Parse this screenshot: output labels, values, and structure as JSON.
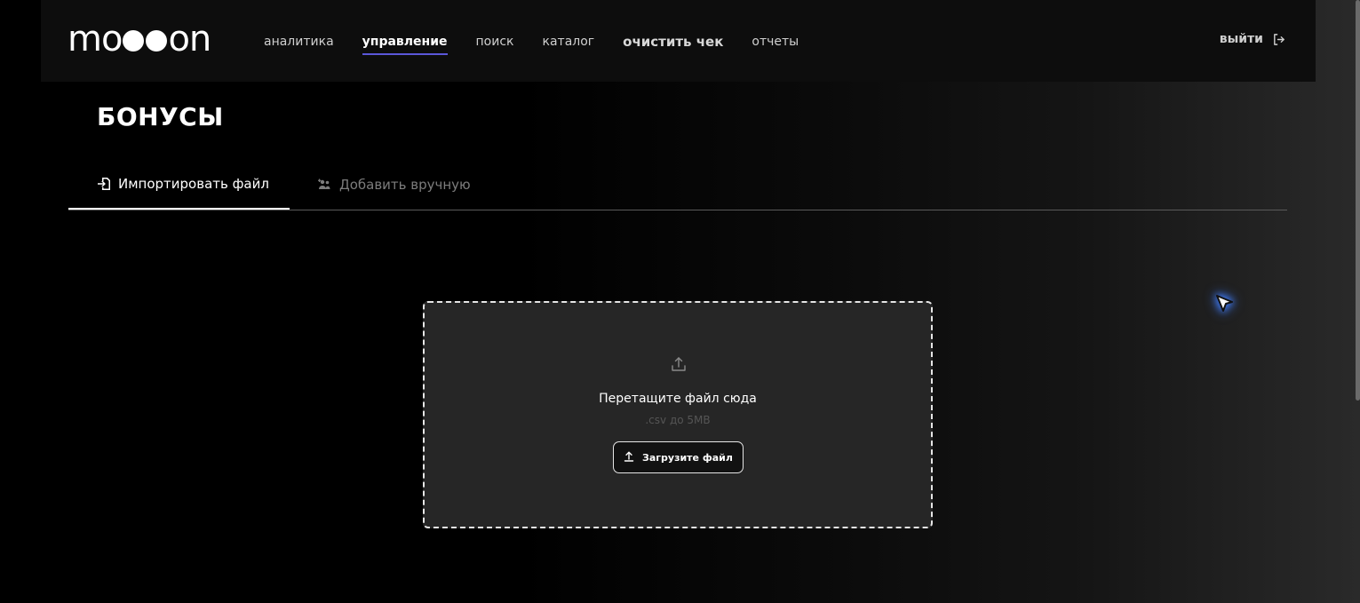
{
  "brand": {
    "logo_prefix": "mo",
    "logo_suffix": "on"
  },
  "nav": {
    "items": [
      {
        "label": "аналитика",
        "active": false
      },
      {
        "label": "управление",
        "active": true
      },
      {
        "label": "поиск",
        "active": false
      },
      {
        "label": "каталог",
        "active": false
      },
      {
        "label": "очистить чек",
        "active": false
      },
      {
        "label": "отчеты",
        "active": false
      }
    ],
    "logout_label": "выйти",
    "active_underline_color": "#5b57d9"
  },
  "page": {
    "title": "БОНУСЫ"
  },
  "tabs": [
    {
      "label": "Импортировать файл",
      "icon": "file-import-icon",
      "active": true
    },
    {
      "label": "Добавить вручную",
      "icon": "add-users-icon",
      "active": false
    }
  ],
  "dropzone": {
    "icon": "upload-icon",
    "title": "Перетащите файл сюда",
    "hint": ".csv до 5MB",
    "button_label": "Загрузите файл"
  },
  "cursor": {
    "icon": "pointer-cursor-icon",
    "glow_color": "#3f7dff"
  }
}
